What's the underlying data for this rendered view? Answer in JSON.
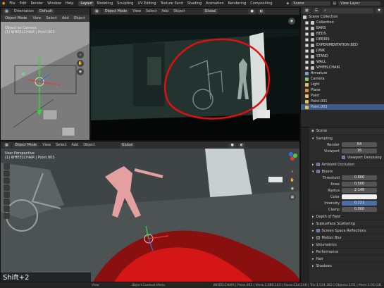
{
  "menu": [
    "File",
    "Edit",
    "Render",
    "Window",
    "Help"
  ],
  "workspaces": [
    "Layout",
    "Modeling",
    "Sculpting",
    "UV Editing",
    "Texture Paint",
    "Shading",
    "Animation",
    "Rendering",
    "Compositing"
  ],
  "active_workspace": "Layout",
  "scene_label": "Scene",
  "view_layer_label": "View Layer",
  "left_viewport": {
    "header": {
      "orientation_label": "Orientation",
      "orientation_value": "Default",
      "mode": "Object Mode",
      "menus": [
        "View",
        "Select",
        "Add",
        "Object"
      ]
    },
    "overlay_title": "Object as Camera",
    "overlay_sub": "(1) WHEELCHAIR | Point.003"
  },
  "top_viewport": {
    "header": {
      "mode": "Object Mode",
      "menus": [
        "View",
        "Select",
        "Add",
        "Object"
      ],
      "transform": "Global"
    }
  },
  "bottom_viewport": {
    "header": {
      "mode": "Object Mode",
      "menus": [
        "View",
        "Select",
        "Add",
        "Object"
      ],
      "transform": "Global"
    },
    "overlay_title": "User Perspective",
    "overlay_sub": "(1) WHEELCHAIR | Point.003"
  },
  "outliner": {
    "root": "Scene Collection",
    "collection": "Collection",
    "items": [
      "BARS",
      "BEDS",
      "DEBRIS",
      "EXPERIMENTATION BED",
      "JUNK",
      "STAND",
      "WALL",
      "WHEELCHAIR",
      "Armature",
      "Camera",
      "Light",
      "Plane",
      "Point",
      "Point.001",
      "Point.003"
    ],
    "selected": "Point.003"
  },
  "properties": {
    "scene_label": "Scene",
    "sampling": {
      "title": "Sampling",
      "render_label": "Render",
      "render_value": "64",
      "viewport_label": "Viewport",
      "viewport_value": "16",
      "denoise_label": "Viewport Denoising"
    },
    "ambient_occlusion": "Ambient Occlusion",
    "bloom": {
      "title": "Bloom",
      "threshold_label": "Threshold",
      "threshold_value": "0.800",
      "knee_label": "Knee",
      "knee_value": "0.500",
      "radius_label": "Radius",
      "radius_value": "2.148",
      "color_label": "Color",
      "intensity_label": "Intensity",
      "intensity_value": "0.221",
      "clamp_label": "Clamp",
      "clamp_value": "0.000"
    },
    "panels": [
      "Depth of Field",
      "Subsurface Scattering",
      "Screen Space Reflections",
      "Motion Blur",
      "Volumetrics",
      "Performance",
      "Hair",
      "Shadows"
    ]
  },
  "shortcut_overlay": "Shift+2",
  "status_bar": {
    "left": "View",
    "middle": "Object Context Menu",
    "right": "WHEELCHAIR | Point.003 | Verts:1,080,143 | Faces:154,148 | Tris:1,534,383 | Objects:1/31 | Mem:1.03 GiB"
  },
  "colors": {
    "accent_blue": "#3c5a8a",
    "selection_red": "#e01010",
    "header": "#2c2c2c"
  }
}
